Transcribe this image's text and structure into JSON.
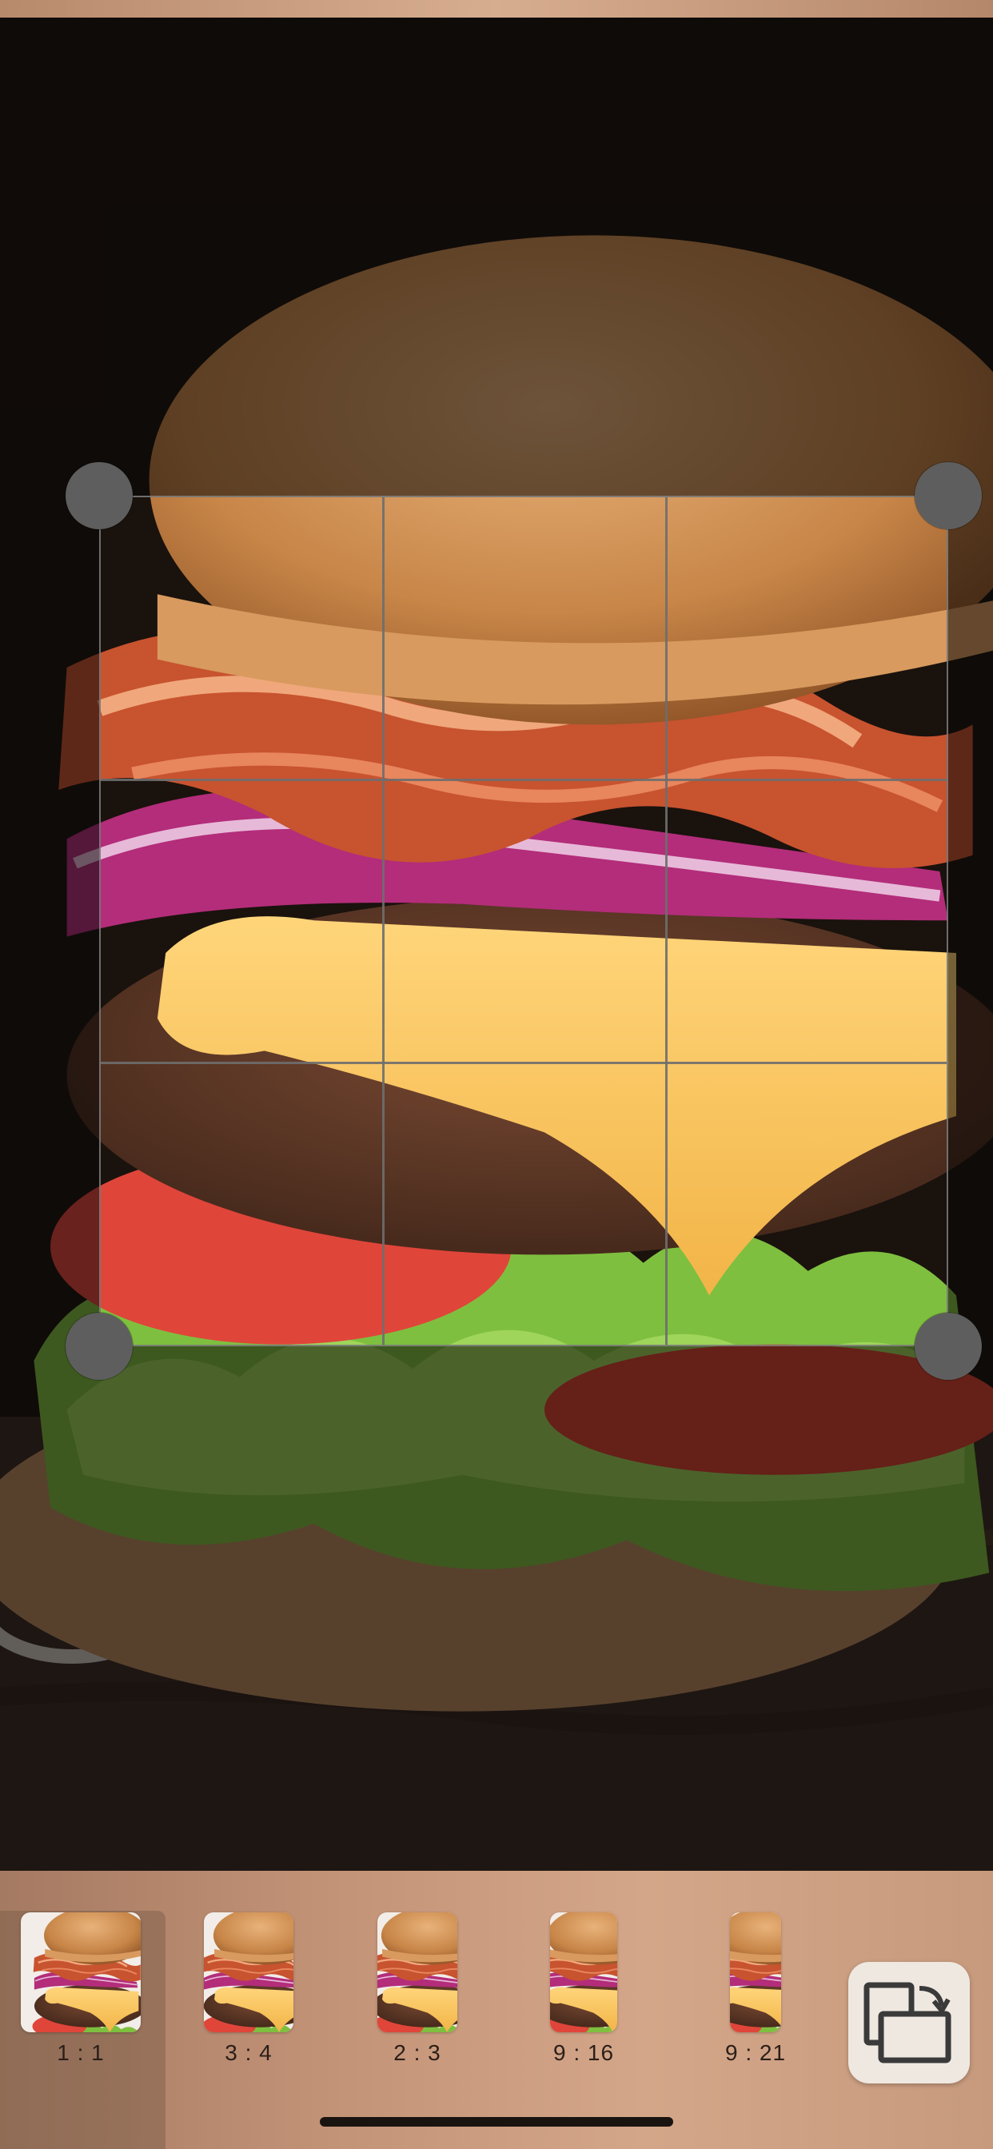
{
  "editor": {
    "image_subject": "burger-photo",
    "crop_grid": "3x3"
  },
  "aspect_ratios": [
    {
      "label": "1 : 1",
      "selected": true
    },
    {
      "label": "3 : 4",
      "selected": false
    },
    {
      "label": "2 : 3",
      "selected": false
    },
    {
      "label": "9 : 16",
      "selected": false
    },
    {
      "label": "9 : 21",
      "selected": false
    }
  ],
  "rotate_button": {
    "icon": "rotate-aspect-icon"
  },
  "colors": {
    "toolbar_bg": "#c49478",
    "handle": "#5e5e5e",
    "grid_line": "#6e6e6e"
  }
}
